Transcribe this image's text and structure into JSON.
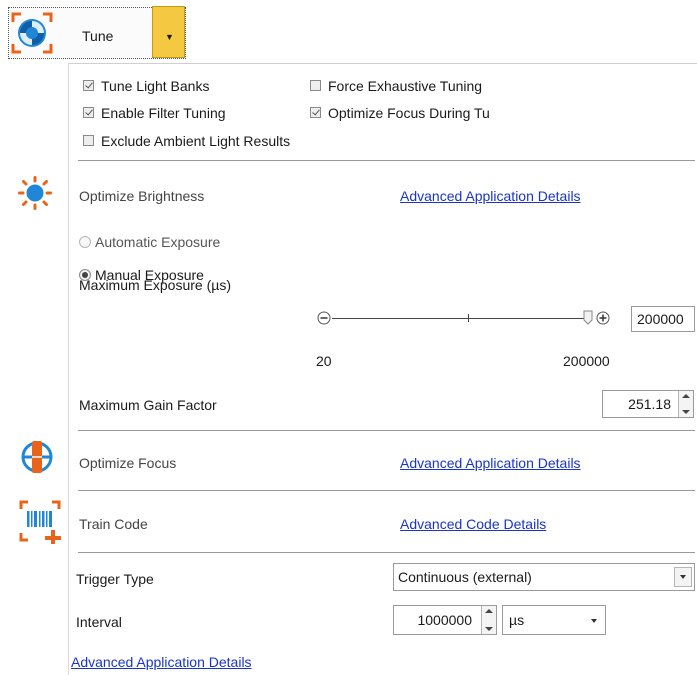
{
  "toolbar": {
    "tune_label": "Tune"
  },
  "options": {
    "tune_light_banks": {
      "label": "Tune Light Banks",
      "checked": true
    },
    "force_exhaustive_tuning": {
      "label": "Force Exhaustive Tuning",
      "checked": false
    },
    "enable_filter_tuning": {
      "label": "Enable Filter Tuning",
      "checked": true
    },
    "optimize_focus_during_tuning": {
      "label": "Optimize Focus During Tu",
      "checked": true
    },
    "exclude_ambient_light_results": {
      "label": "Exclude Ambient Light Results",
      "checked": false
    }
  },
  "brightness": {
    "title": "Optimize Brightness",
    "link": "Advanced Application Details",
    "automatic_exposure": "Automatic Exposure",
    "manual_exposure": "Manual Exposure",
    "max_exposure_label": "Maximum Exposure (µs)",
    "max_exposure_value": "200000",
    "slider_min": "20",
    "slider_max": "200000",
    "gain_label": "Maximum Gain Factor",
    "gain_value": "251.18"
  },
  "focus": {
    "title": "Optimize Focus",
    "link": "Advanced Application Details"
  },
  "train_code": {
    "title": "Train Code",
    "link": "Advanced Code Details"
  },
  "trigger": {
    "type_label": "Trigger Type",
    "type_value": "Continuous (external)",
    "interval_label": "Interval",
    "interval_value": "1000000",
    "interval_unit": "µs"
  },
  "footer": {
    "link": "Advanced Application Details"
  },
  "colors": {
    "link": "#1a34c8",
    "accent_blue": "#1f86d8",
    "accent_orange": "#e8641b",
    "tune_arrow": "#f5c842"
  }
}
